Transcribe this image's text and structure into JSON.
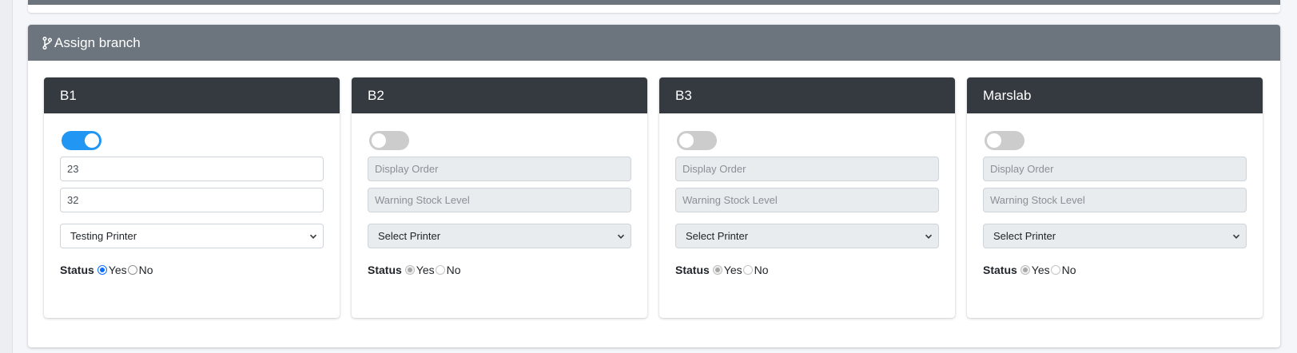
{
  "section": {
    "title": "Assign branch"
  },
  "branches": [
    {
      "name": "B1",
      "enabled": true,
      "display_order": {
        "value": "23",
        "placeholder": "Display Order"
      },
      "warning_stock": {
        "value": "32",
        "placeholder": "Warning Stock Level"
      },
      "printer": "Testing Printer",
      "status_label": "Status",
      "status_yes": "Yes",
      "status_no": "No"
    },
    {
      "name": "B2",
      "enabled": false,
      "display_order": {
        "value": "",
        "placeholder": "Display Order"
      },
      "warning_stock": {
        "value": "",
        "placeholder": "Warning Stock Level"
      },
      "printer": "Select Printer",
      "status_label": "Status",
      "status_yes": "Yes",
      "status_no": "No"
    },
    {
      "name": "B3",
      "enabled": false,
      "display_order": {
        "value": "",
        "placeholder": "Display Order"
      },
      "warning_stock": {
        "value": "",
        "placeholder": "Warning Stock Level"
      },
      "printer": "Select Printer",
      "status_label": "Status",
      "status_yes": "Yes",
      "status_no": "No"
    },
    {
      "name": "Marslab",
      "enabled": false,
      "display_order": {
        "value": "",
        "placeholder": "Display Order"
      },
      "warning_stock": {
        "value": "",
        "placeholder": "Warning Stock Level"
      },
      "printer": "Select Printer",
      "status_label": "Status",
      "status_yes": "Yes",
      "status_no": "No"
    }
  ],
  "colors": {
    "section_header": "#6c757d",
    "card_header": "#343a40",
    "toggle_on": "#2196f3",
    "toggle_off": "#cccccc",
    "radio_active": "#0d6efd"
  },
  "icons": {
    "section": "code-branch-icon",
    "select": "chevron-down-icon"
  }
}
